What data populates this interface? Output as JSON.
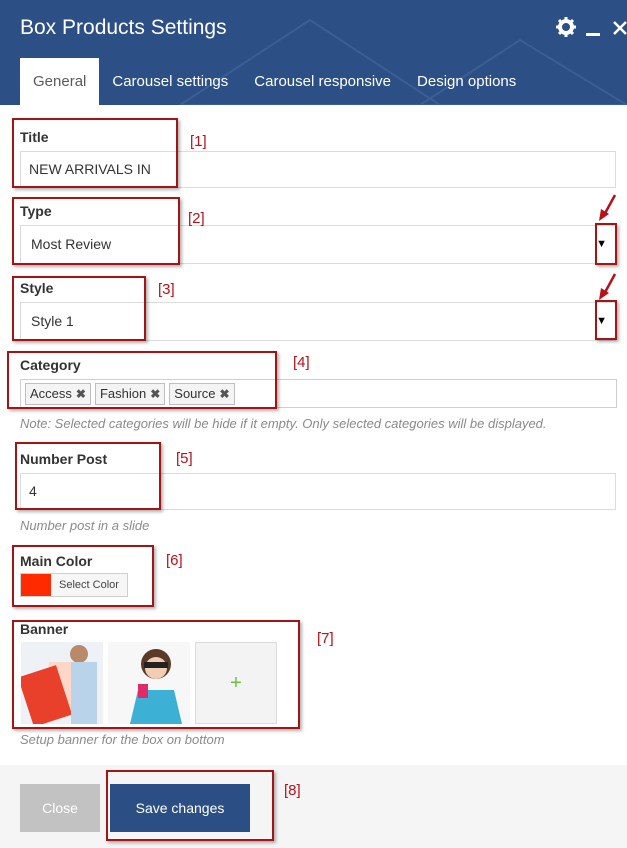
{
  "header": {
    "title": "Box Products Settings",
    "tabs": [
      {
        "label": "General",
        "active": true
      },
      {
        "label": "Carousel settings"
      },
      {
        "label": "Carousel responsive"
      },
      {
        "label": "Design options"
      }
    ],
    "icons": [
      "gear-icon",
      "minimize-icon",
      "close-icon"
    ]
  },
  "fields": {
    "title": {
      "label": "Title",
      "value": "NEW ARRIVALS IN"
    },
    "type": {
      "label": "Type",
      "value": "Most Review"
    },
    "style": {
      "label": "Style",
      "value": "Style 1"
    },
    "category": {
      "label": "Category",
      "tags": [
        "Access",
        "Fashion",
        "Source"
      ],
      "note": "Note: Selected categories will be hide if it empty. Only selected categories will be displayed."
    },
    "number_post": {
      "label": "Number Post",
      "value": "4",
      "note": "Number post in a slide"
    },
    "main_color": {
      "label": "Main Color",
      "color": "#ff2a00",
      "button": "Select Color"
    },
    "banner": {
      "label": "Banner",
      "add": "+",
      "note": "Setup banner for the box on bottom"
    }
  },
  "markers": [
    "[1]",
    "[2]",
    "[3]",
    "[4]",
    "[5]",
    "[6]",
    "[7]",
    "[8]"
  ],
  "footer": {
    "close_label": "Close",
    "save_label": "Save changes"
  },
  "colors": {
    "header": "#2c4f86",
    "marker": "#b5121b",
    "save": "#2b4f84",
    "close": "#c2c2c2"
  }
}
